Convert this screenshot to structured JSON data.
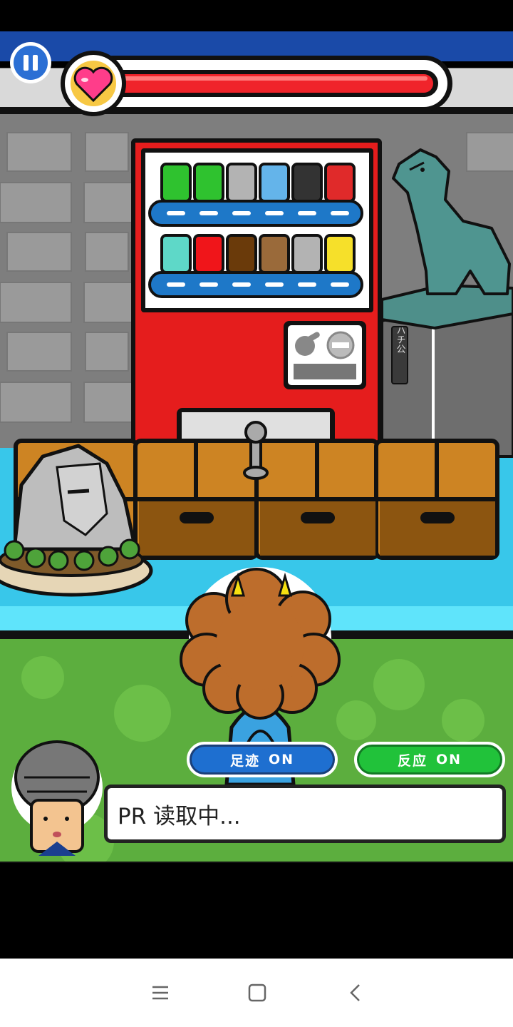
{
  "hud": {
    "pause_icon": "pause-icon",
    "heart_icon": "heart-icon",
    "health_fraction": 1.0
  },
  "scene": {
    "statue_plaque": "ハチ公"
  },
  "toggles": {
    "footprint": {
      "label": "足迹",
      "state": "ON",
      "color": "#1e6fd0"
    },
    "reaction": {
      "label": "反应",
      "state": "ON",
      "color": "#21c23a"
    }
  },
  "dialog": {
    "text": "PR 读取中..."
  },
  "navbar": {
    "menu_icon": "menu-icon",
    "home_icon": "home-icon",
    "back_icon": "back-icon"
  }
}
